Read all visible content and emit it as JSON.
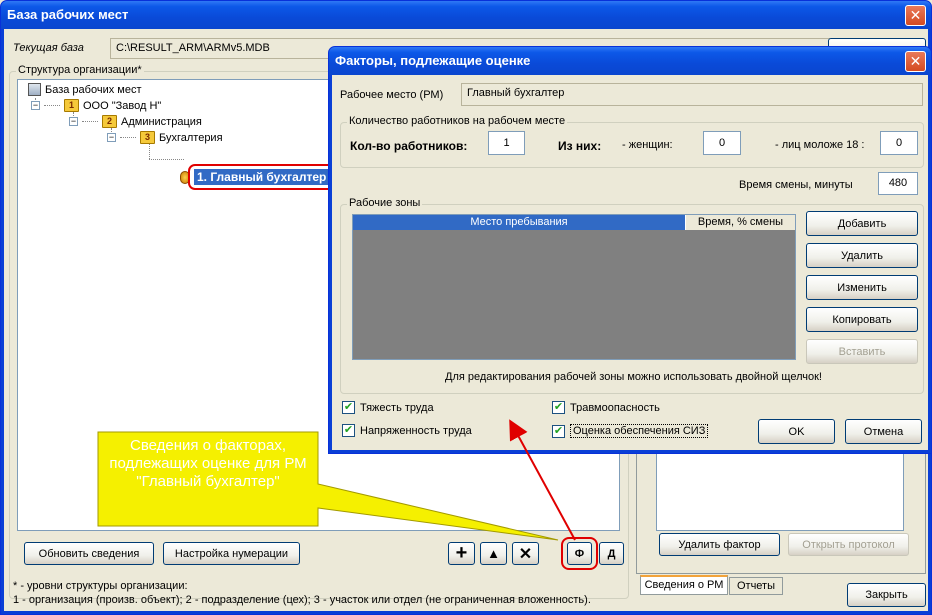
{
  "main_window": {
    "title": "База рабочих мест",
    "db_label": "Текущая база",
    "db_path": "C:\\RESULT_ARM\\ARMv5.MDB",
    "structure_label": "Структура организации*",
    "tree": {
      "root": "База рабочих мест",
      "org": "ООО \"Завод Н\"",
      "org_level": "1",
      "dept": "Администрация",
      "dept_level": "2",
      "section": "Бухгалтерия",
      "section_level": "3",
      "workplace": "1. Главный бухгалтер"
    },
    "buttons": {
      "refresh": "Обновить сведения",
      "numbering": "Настройка нумерации",
      "add": "+",
      "up": "▲",
      "delete": "✕",
      "factors": "Ф",
      "d": "Д",
      "close": "Закрыть",
      "delete_factor": "Удалить фактор",
      "open_protocol": "Открыть протокол"
    },
    "tabs": [
      "Сведения о РМ",
      "Отчеты"
    ],
    "footnote_1": "* - уровни структуры организации:",
    "footnote_2": "1 - организация (произв. объект); 2 - подразделение (цех); 3 - участок или отдел (не ограниченная вложенность)."
  },
  "dialog": {
    "title": "Факторы, подлежащие оценке",
    "workplace_label": "Рабочее место (РМ)",
    "workplace_value": "Главный бухгалтер",
    "workers_group": "Количество работников на рабочем месте",
    "workers_count_label": "Кол-во работников:",
    "workers_count": "1",
    "of_them_label": "Из них:",
    "women_label": "- женщин:",
    "women_count": "0",
    "under18_label": "- лиц моложе 18 :",
    "under18_count": "0",
    "shift_label": "Время смены, минуты",
    "shift_value": "480",
    "zones_group": "Рабочие зоны",
    "zones_columns": [
      "Место пребывания",
      "Время, % смены"
    ],
    "zones_buttons": {
      "add": "Добавить",
      "delete": "Удалить",
      "edit": "Изменить",
      "copy": "Копировать",
      "paste": "Вставить"
    },
    "zones_hint": "Для редактирования рабочей зоны можно использовать двойной щелчок!",
    "checkboxes": [
      {
        "label": "Тяжесть труда",
        "checked": true
      },
      {
        "label": "Травмоопасность",
        "checked": true
      },
      {
        "label": "Напряженность труда",
        "checked": true
      },
      {
        "label": "Оценка обеспечения СИЗ",
        "checked": true
      }
    ],
    "ok": "OK",
    "cancel": "Отмена"
  },
  "callout": {
    "text": "Сведения о факторах, подлежащих оценке для РМ \"Главный бухгалтер\"",
    "color": "#f5f000"
  },
  "colors": {
    "titlebar": "#0a4ad8",
    "highlight": "#e00000",
    "selection": "#316ac5"
  },
  "icons": {
    "check": "✔",
    "close": "✕",
    "minus": "−"
  }
}
